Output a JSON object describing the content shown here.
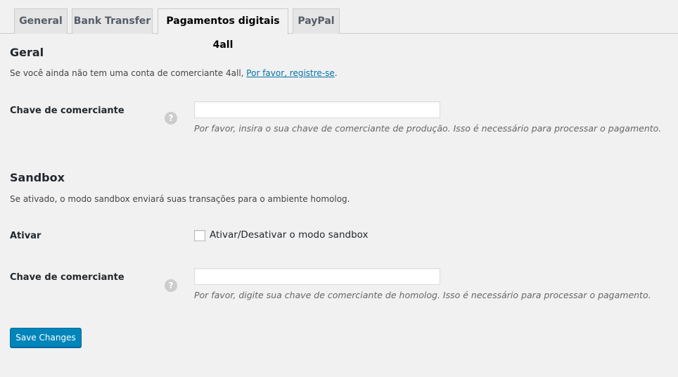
{
  "tabs": [
    {
      "label": "General",
      "active": false
    },
    {
      "label": "Bank Transfer",
      "active": false
    },
    {
      "label": "Pagamentos digitais 4all",
      "active": true
    },
    {
      "label": "PayPal",
      "active": false
    }
  ],
  "geral": {
    "title": "Geral",
    "description_prefix": "Se você ainda não tem uma conta de comerciante 4all, ",
    "register_link": "Por favor, registre-se",
    "description_suffix": ".",
    "merchant_key": {
      "label": "Chave de comerciante",
      "value": "",
      "hint": "Por favor, insira o sua chave de comerciante de produção. Isso é necessário para processar o pagamento."
    }
  },
  "sandbox": {
    "title": "Sandbox",
    "description": "Se ativado, o modo sandbox enviará suas transações para o ambiente homolog.",
    "enable": {
      "label": "Ativar",
      "checkbox_label": "Ativar/Desativar o modo sandbox",
      "checked": false
    },
    "merchant_key": {
      "label": "Chave de comerciante",
      "value": "",
      "hint": "Por favor, digite sua chave de comerciante de homolog. Isso é necessário para processar o pagamento."
    }
  },
  "help_icon_glyph": "?",
  "save_label": "Save Changes",
  "colors": {
    "accent": "#0085ba",
    "link": "#0073aa",
    "background": "#f1f1f1"
  }
}
